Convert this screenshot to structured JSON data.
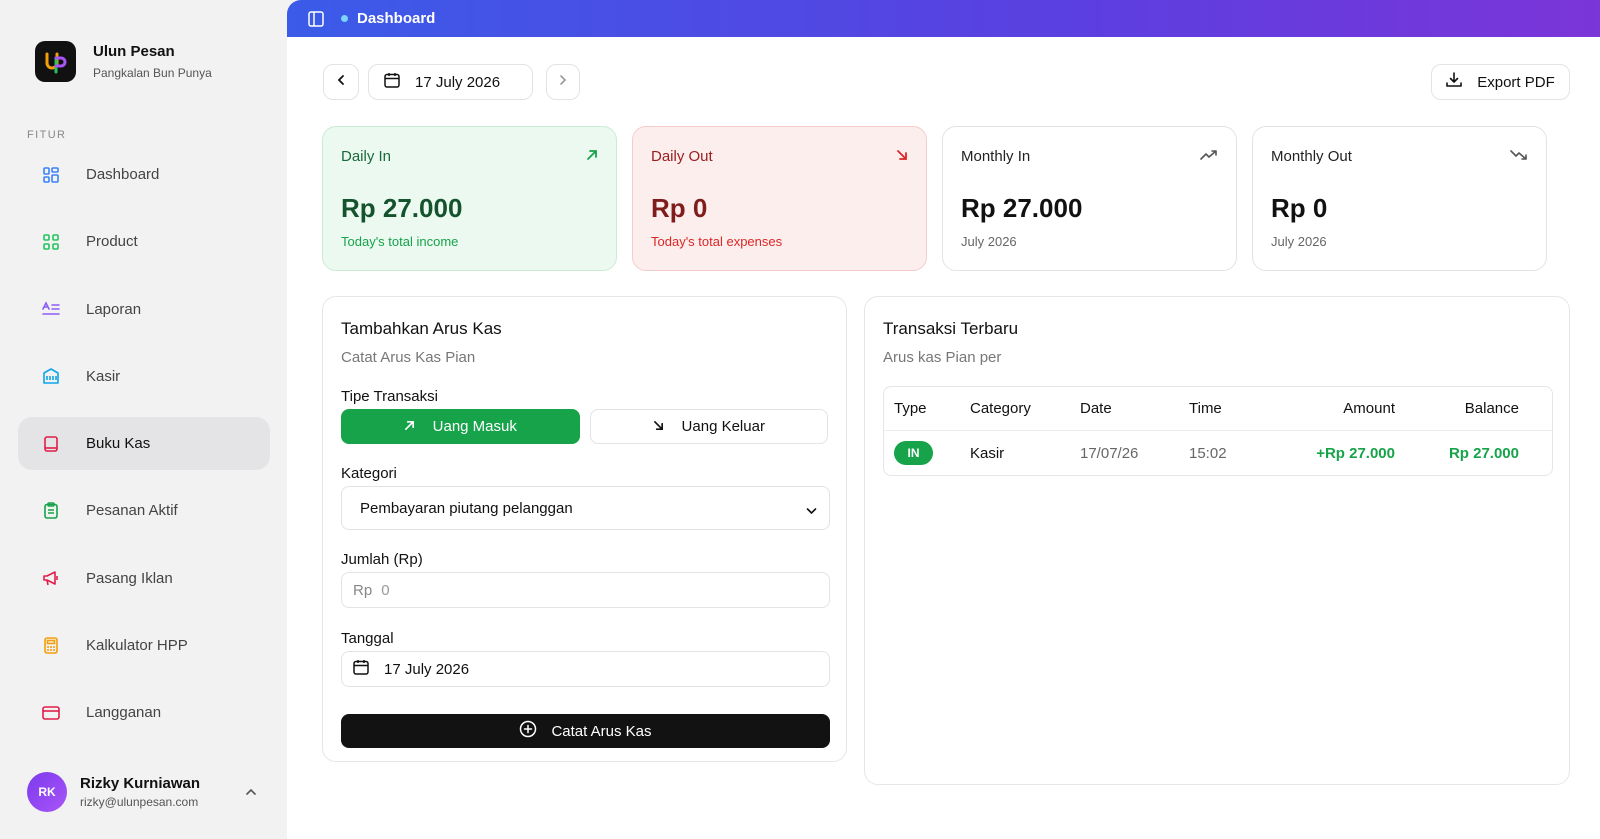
{
  "brand": {
    "name": "Ulun Pesan",
    "subtitle": "Pangkalan Bun Punya"
  },
  "sidebar": {
    "section_label": "FITUR",
    "items": [
      {
        "label": "Dashboard",
        "icon": "dashboard-icon",
        "color": "#3b82f6"
      },
      {
        "label": "Product",
        "icon": "grid-icon",
        "color": "#22c55e"
      },
      {
        "label": "Laporan",
        "icon": "text-list-icon",
        "color": "#8b5cf6"
      },
      {
        "label": "Kasir",
        "icon": "cashier-icon",
        "color": "#0ea5e9"
      },
      {
        "label": "Buku Kas",
        "icon": "book-icon",
        "color": "#e11d48",
        "active": true
      },
      {
        "label": "Pesanan Aktif",
        "icon": "clipboard-icon",
        "color": "#16a34a"
      },
      {
        "label": "Pasang Iklan",
        "icon": "megaphone-icon",
        "color": "#e11d48"
      },
      {
        "label": "Kalkulator HPP",
        "icon": "calculator-icon",
        "color": "#f59e0b"
      },
      {
        "label": "Langganan",
        "icon": "credit-card-icon",
        "color": "#e11d48"
      }
    ]
  },
  "user": {
    "initials": "RK",
    "name": "Rizky Kurniawan",
    "email": "rizky@ulunpesan.com"
  },
  "topbar": {
    "breadcrumb": "Dashboard"
  },
  "toolbar": {
    "date": "17 July 2026",
    "export_label": "Export PDF"
  },
  "stats": [
    {
      "title": "Daily In",
      "value": "Rp 27.000",
      "sub": "Today's total income",
      "icon": "arrow-up-right-icon"
    },
    {
      "title": "Daily Out",
      "value": "Rp 0",
      "sub": "Today's total expenses",
      "icon": "arrow-down-right-icon"
    },
    {
      "title": "Monthly In",
      "value": "Rp 27.000",
      "sub": "July 2026",
      "icon": "trending-up-icon"
    },
    {
      "title": "Monthly Out",
      "value": "Rp 0",
      "sub": "July 2026",
      "icon": "trending-down-icon"
    }
  ],
  "form": {
    "title": "Tambahkan Arus Kas",
    "subtitle": "Catat Arus Kas Pian",
    "type_label": "Tipe Transaksi",
    "type_in": "Uang Masuk",
    "type_out": "Uang Keluar",
    "category_label": "Kategori",
    "category_value": "Pembayaran piutang pelanggan",
    "amount_label": "Jumlah (Rp)",
    "amount_prefix": "Rp",
    "amount_placeholder": "0",
    "date_label": "Tanggal",
    "date_value": "17 July 2026",
    "submit_label": "Catat Arus Kas"
  },
  "transactions": {
    "title": "Transaksi Terbaru",
    "subtitle": "Arus kas Pian per",
    "columns": [
      "Type",
      "Category",
      "Date",
      "Time",
      "Amount",
      "Balance"
    ],
    "rows": [
      {
        "type": "IN",
        "category": "Kasir",
        "date": "17/07/26",
        "time": "15:02",
        "amount": "+Rp 27.000",
        "balance": "Rp 27.000"
      }
    ]
  },
  "colors": {
    "accent_green": "#16a34a",
    "accent_red": "#dc2626",
    "topbar_start": "#3b5be8",
    "topbar_end": "#7b35d8"
  }
}
